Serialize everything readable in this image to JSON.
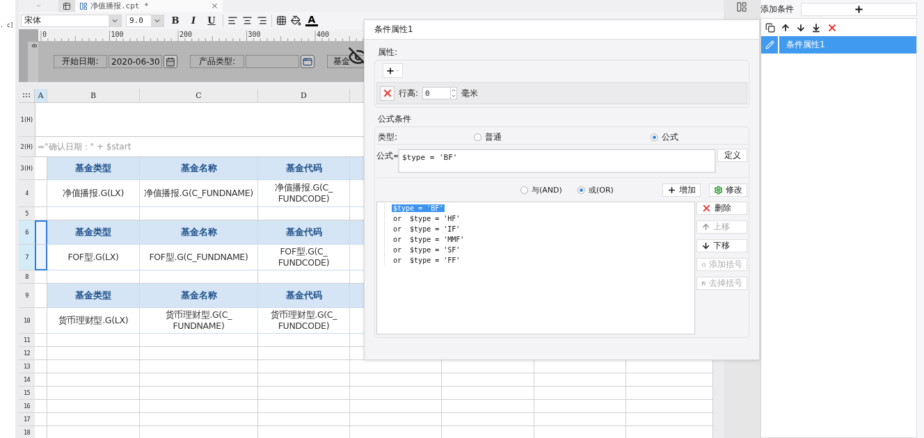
{
  "left_strip": {
    "text": ". c]"
  },
  "tabs": [
    {
      "label": "净值播报.cpt *",
      "selected": true
    }
  ],
  "toolbar": {
    "font": "宋体",
    "size": "9.0",
    "style_buttons": [
      "B",
      "I",
      "U"
    ],
    "font_color_label": "A"
  },
  "ruler": {
    "marks": [
      "0",
      "100",
      "200",
      "300",
      "400"
    ],
    "vertical_mark": "0"
  },
  "parameters": [
    {
      "kind": "date",
      "label": "开始日期:",
      "value": "2020-06-30"
    },
    {
      "kind": "combo",
      "label": "产品类型:"
    },
    {
      "kind": "label",
      "label": "基金"
    }
  ],
  "sheet": {
    "columns": [
      {
        "label": "A",
        "selected": true
      },
      {
        "label": "B",
        "selected": false
      },
      {
        "label": "C",
        "selected": false
      },
      {
        "label": "D",
        "selected": false
      }
    ],
    "rows": [
      {
        "label": "1(H)",
        "kind": "blank",
        "selected": false
      },
      {
        "label": "2(H)",
        "kind": "formula",
        "selected": false,
        "text": "=\"确认日期：\" + $start"
      },
      {
        "label": "3(H)",
        "kind": "header",
        "selected": false,
        "cells": [
          "基金类型",
          "基金名称",
          "基金代码"
        ]
      },
      {
        "label": "4",
        "kind": "data",
        "selected": false,
        "cells": [
          "净值播报.G(LX)",
          "净值播报.G(C_FUNDNAME)",
          "净值播报.G(C_\nFUNDCODE)"
        ]
      },
      {
        "label": "5",
        "kind": "empty",
        "selected": false
      },
      {
        "label": "6",
        "kind": "header",
        "selected": true,
        "cells": [
          "基金类型",
          "基金名称",
          "基金代码"
        ]
      },
      {
        "label": "7",
        "kind": "data",
        "selected": true,
        "cells": [
          "FOF型.G(LX)",
          "FOF型.G(C_FUNDNAME)",
          "FOF型.G(C_\nFUNDCODE)"
        ]
      },
      {
        "label": "8",
        "kind": "empty",
        "selected": false
      },
      {
        "label": "9",
        "kind": "header",
        "selected": false,
        "cells": [
          "基金类型",
          "基金名称",
          "基金代码"
        ]
      },
      {
        "label": "10",
        "kind": "data",
        "selected": false,
        "cells": [
          "货币理财型.G(LX)",
          "货币理财型.G(C_\nFUNDNAME)",
          "货币理财型.G(C_\nFUNDCODE)"
        ]
      },
      {
        "label": "11",
        "kind": "empty",
        "selected": false
      },
      {
        "label": "12",
        "kind": "empty",
        "selected": false
      },
      {
        "label": "13",
        "kind": "empty",
        "selected": false
      },
      {
        "label": "14",
        "kind": "empty",
        "selected": false
      },
      {
        "label": "15",
        "kind": "empty",
        "selected": false
      },
      {
        "label": "16",
        "kind": "empty",
        "selected": false
      },
      {
        "label": "17",
        "kind": "empty",
        "selected": false
      },
      {
        "label": "18",
        "kind": "empty",
        "selected": false
      }
    ]
  },
  "dialog": {
    "title": "条件属性1",
    "attributes": {
      "legend": "属性:",
      "row_height_label": "行高:",
      "row_height_value": "0",
      "unit": "毫米"
    },
    "formula_condition": {
      "legend": "公式条件",
      "type_label": "类型:",
      "types": [
        {
          "label": "普通",
          "selected": false
        },
        {
          "label": "公式",
          "selected": true
        }
      ],
      "formula_label": "公式=",
      "formula_value": "$type = 'BF'",
      "define_button": "定义",
      "joins": [
        {
          "label": "与(AND)",
          "selected": false
        },
        {
          "label": "或(OR)",
          "selected": true
        }
      ],
      "add_button": "增加",
      "modify_button": "修改",
      "conditions": [
        {
          "text": "$type = 'BF'",
          "selected": true
        },
        {
          "text": "or  $type = 'HF'",
          "selected": false
        },
        {
          "text": "or  $type = 'IF'",
          "selected": false
        },
        {
          "text": "or  $type = 'MMF'",
          "selected": false
        },
        {
          "text": "or  $type = 'SF'",
          "selected": false
        },
        {
          "text": "or  $type = 'FF'",
          "selected": false
        }
      ],
      "side_buttons": [
        {
          "kind": "delete",
          "label": "删除",
          "disabled": false
        },
        {
          "kind": "up",
          "label": "上移",
          "disabled": true
        },
        {
          "kind": "down",
          "label": "下移",
          "disabled": false
        },
        {
          "kind": "add_paren",
          "label": "添加括号",
          "disabled": true
        },
        {
          "kind": "remove_paren",
          "label": "去掉括号",
          "disabled": true
        }
      ]
    }
  },
  "right_panel": {
    "title": "添加条件",
    "items": [
      {
        "label": "条件属性1",
        "selected": true
      }
    ]
  }
}
